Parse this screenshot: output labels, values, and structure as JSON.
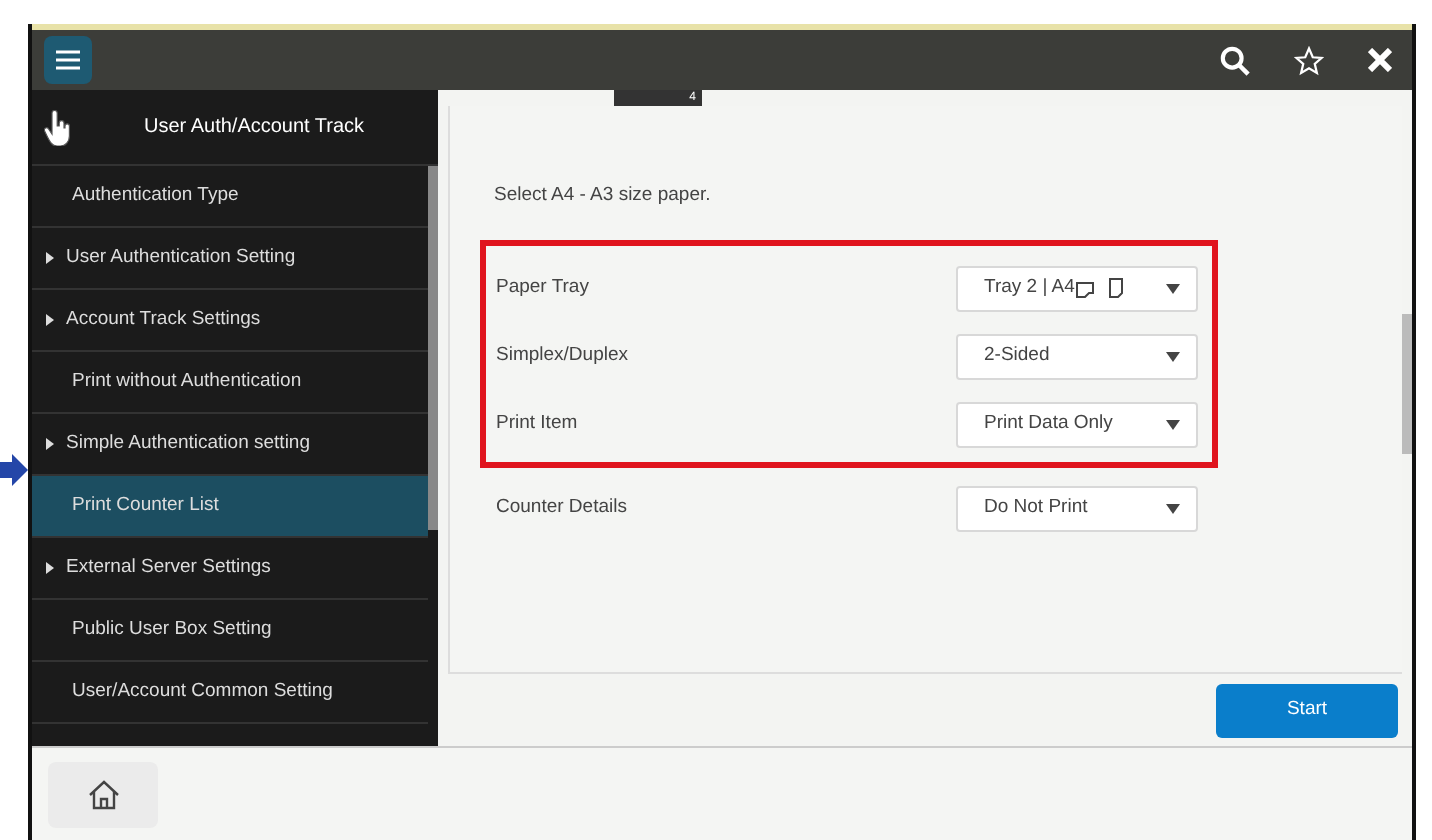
{
  "page_tab": "4",
  "sidebar": {
    "title": "User Auth/Account Track",
    "items": [
      {
        "label": "Authentication Type",
        "expandable": false,
        "selected": false
      },
      {
        "label": "User Authentication Setting",
        "expandable": true,
        "selected": false
      },
      {
        "label": "Account Track Settings",
        "expandable": true,
        "selected": false
      },
      {
        "label": "Print without Authentication",
        "expandable": false,
        "selected": false
      },
      {
        "label": "Simple Authentication setting",
        "expandable": true,
        "selected": false
      },
      {
        "label": "Print Counter List",
        "expandable": false,
        "selected": true
      },
      {
        "label": "External Server Settings",
        "expandable": true,
        "selected": false
      },
      {
        "label": "Public User Box Setting",
        "expandable": false,
        "selected": false
      },
      {
        "label": "User/Account Common Setting",
        "expandable": false,
        "selected": false
      }
    ]
  },
  "form": {
    "instruction": "Select A4 - A3 size paper.",
    "groups": [
      {
        "highlighted": true,
        "rows": [
          {
            "label": "Paper Tray",
            "value": "Tray 2 | A4",
            "paper_icons": true
          },
          {
            "label": "Simplex/Duplex",
            "value": "2-Sided",
            "paper_icons": false
          },
          {
            "label": "Print Item",
            "value": "Print Data Only",
            "paper_icons": false
          }
        ]
      },
      {
        "highlighted": false,
        "rows": [
          {
            "label": "Counter Details",
            "value": "Do Not Print",
            "paper_icons": false
          }
        ]
      }
    ]
  },
  "start_button": "Start"
}
